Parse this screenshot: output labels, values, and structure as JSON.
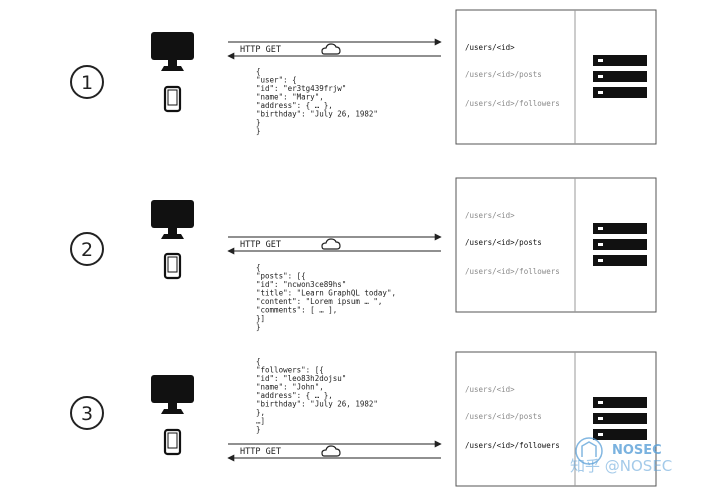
{
  "steps": [
    {
      "number": "1",
      "request_label": "HTTP GET",
      "endpoints": [
        "/users/<id>",
        "/users/<id>/posts",
        "/users/<id>/followers"
      ],
      "active_endpoint": 0,
      "response_lines": [
        "{",
        "  \"user\": {",
        "    \"id\": \"er3tg439frjw\"",
        "    \"name\": \"Mary\",",
        "    \"address\": { … },",
        "    \"birthday\": \"July 26, 1982\"",
        "  }",
        "}"
      ]
    },
    {
      "number": "2",
      "request_label": "HTTP GET",
      "endpoints": [
        "/users/<id>",
        "/users/<id>/posts",
        "/users/<id>/followers"
      ],
      "active_endpoint": 1,
      "response_lines": [
        "{",
        "  \"posts\": [{",
        "    \"id\": \"ncwon3ce89hs\"",
        "    \"title\": \"Learn GraphQL today\",",
        "    \"content\": \"Lorem ipsum … \",",
        "    \"comments\": [ … ],",
        "  }]",
        "}"
      ]
    },
    {
      "number": "3",
      "request_label": "HTTP GET",
      "endpoints": [
        "/users/<id>",
        "/users/<id>/posts",
        "/users/<id>/followers"
      ],
      "active_endpoint": 2,
      "response_lines": [
        "{",
        "  \"followers\": [{",
        "    \"id\": \"leo83h2dojsu\"",
        "    \"name\": \"John\",",
        "    \"address\": { … },",
        "    \"birthday\": \"July 26, 1982\"",
        "  },",
        "  …]",
        "}"
      ]
    }
  ],
  "watermark": {
    "brand": "NOSEC",
    "text": "知乎 @NOSEC"
  },
  "colors": {
    "line": "#222222",
    "muted_text": "#8a8a8a",
    "active_text": "#111111",
    "box_border": "#555555",
    "divider": "#9a9a9a",
    "watermark": "#5aa0d8"
  },
  "icons": [
    "desktop-monitor-icon",
    "smartphone-icon",
    "cloud-icon",
    "server-rack-icon",
    "arrow-icon"
  ]
}
